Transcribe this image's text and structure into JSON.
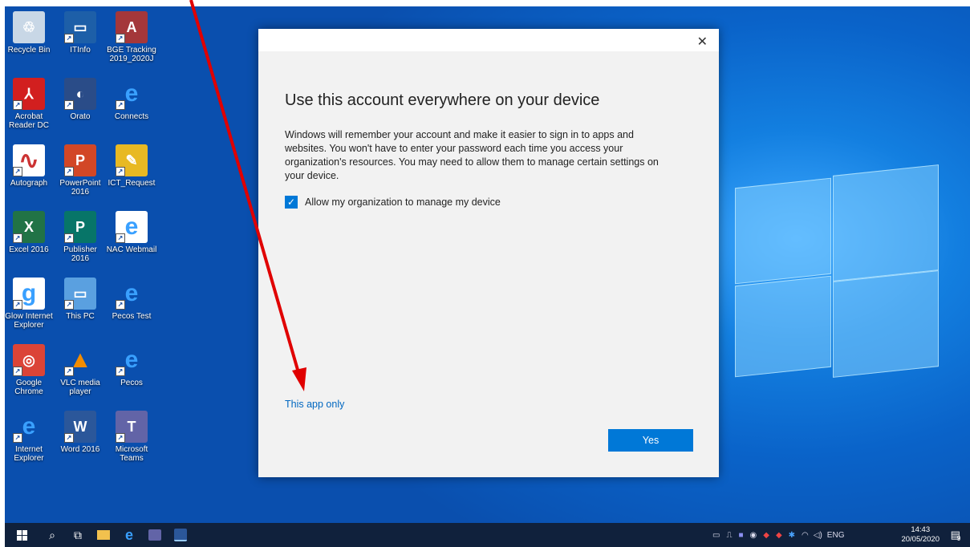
{
  "desktop_icons": [
    {
      "label": "Recycle Bin",
      "icon": "recycle-bin-icon"
    },
    {
      "label": "ITInfo",
      "icon": "monitor-icon"
    },
    {
      "label": "BGE Tracking 2019_2020J",
      "icon": "access-file-icon"
    },
    {
      "label": "Acrobat Reader DC",
      "icon": "acrobat-icon"
    },
    {
      "label": "Orato",
      "icon": "orato-icon"
    },
    {
      "label": "Connects",
      "icon": "ie-icon"
    },
    {
      "label": "Autograph",
      "icon": "autograph-icon"
    },
    {
      "label": "PowerPoint 2016",
      "icon": "powerpoint-icon"
    },
    {
      "label": "ICT_Request",
      "icon": "ict-request-icon"
    },
    {
      "label": "Excel 2016",
      "icon": "excel-icon"
    },
    {
      "label": "Publisher 2016",
      "icon": "publisher-icon"
    },
    {
      "label": "NAC Webmail",
      "icon": "ie-file-icon"
    },
    {
      "label": "Glow Internet Explorer",
      "icon": "glow-file-icon"
    },
    {
      "label": "This PC",
      "icon": "this-pc-icon"
    },
    {
      "label": "Pecos Test",
      "icon": "ie-icon"
    },
    {
      "label": "Google Chrome",
      "icon": "chrome-icon"
    },
    {
      "label": "VLC media player",
      "icon": "vlc-icon"
    },
    {
      "label": "Pecos",
      "icon": "ie-icon"
    },
    {
      "label": "Internet Explorer",
      "icon": "ie-icon"
    },
    {
      "label": "Word 2016",
      "icon": "word-icon"
    },
    {
      "label": "Microsoft Teams",
      "icon": "teams-icon"
    }
  ],
  "dialog": {
    "close_label": "✕",
    "title": "Use this account everywhere on your device",
    "body": "Windows will remember your account and make it easier to sign in to apps and websites. You won't have to enter your password each time you access your organization's resources. You may need to allow them to manage certain settings on your device.",
    "checkbox_label": "Allow my organization to manage my device",
    "checkbox_checked": true,
    "link_label": "This app only",
    "yes_label": "Yes"
  },
  "taskbar": {
    "language": "ENG",
    "time": "14:43",
    "date": "20/05/2020",
    "notification_count": "9"
  },
  "colors": {
    "accent": "#0078d7",
    "link": "#0067c0",
    "annotation_arrow": "#e00000"
  }
}
